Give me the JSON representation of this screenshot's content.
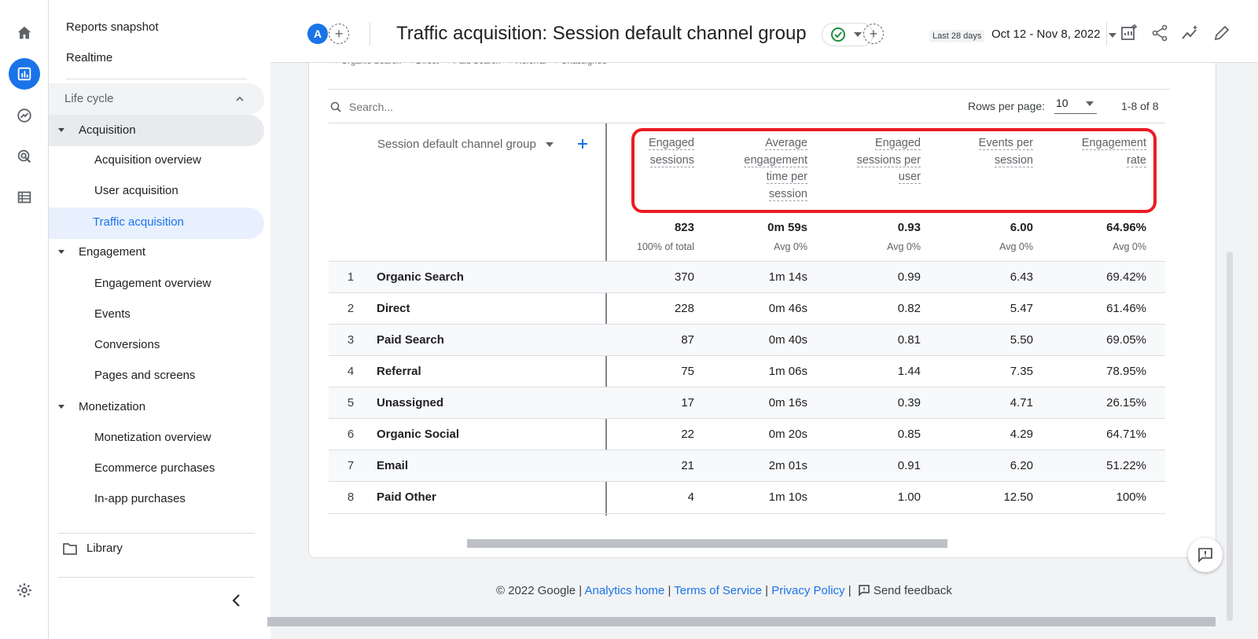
{
  "nav": {
    "reports_snapshot": "Reports snapshot",
    "realtime": "Realtime",
    "lifecycle": "Life cycle",
    "acquisition": "Acquisition",
    "acquisition_overview": "Acquisition overview",
    "user_acquisition": "User acquisition",
    "traffic_acquisition": "Traffic acquisition",
    "engagement": "Engagement",
    "engagement_overview": "Engagement overview",
    "events": "Events",
    "conversions": "Conversions",
    "pages_and_screens": "Pages and screens",
    "monetization": "Monetization",
    "monetization_overview": "Monetization overview",
    "ecommerce_purchases": "Ecommerce purchases",
    "in_app_purchases": "In-app purchases",
    "library": "Library"
  },
  "header": {
    "avatar_letter": "A",
    "title": "Traffic acquisition: Session default channel group",
    "date_preset": "Last 28 days",
    "date_range": "Oct 12 - Nov 8, 2022"
  },
  "legend": {
    "items": [
      "Organic Search",
      "Direct",
      "Paid Search",
      "Referral",
      "Unassigned"
    ]
  },
  "toolbar": {
    "search_placeholder": "Search...",
    "rows_per_page_label": "Rows per page:",
    "rows_per_page_value": "10",
    "pager": "1-8 of 8"
  },
  "table": {
    "dimension_header": "Session default channel group",
    "metric_headers": [
      [
        "Engaged",
        "sessions"
      ],
      [
        "Average",
        "engagement",
        "time per",
        "session"
      ],
      [
        "Engaged",
        "sessions per",
        "user"
      ],
      [
        "Events per",
        "session"
      ],
      [
        "Engagement",
        "rate"
      ]
    ],
    "totals": [
      "823",
      "0m 59s",
      "0.93",
      "6.00",
      "64.96%"
    ],
    "totals_sub": [
      "100% of total",
      "Avg 0%",
      "Avg 0%",
      "Avg 0%",
      "Avg 0%"
    ],
    "rows": [
      {
        "n": "1",
        "name": "Organic Search",
        "v": [
          "370",
          "1m 14s",
          "0.99",
          "6.43",
          "69.42%"
        ]
      },
      {
        "n": "2",
        "name": "Direct",
        "v": [
          "228",
          "0m 46s",
          "0.82",
          "5.47",
          "61.46%"
        ]
      },
      {
        "n": "3",
        "name": "Paid Search",
        "v": [
          "87",
          "0m 40s",
          "0.81",
          "5.50",
          "69.05%"
        ]
      },
      {
        "n": "4",
        "name": "Referral",
        "v": [
          "75",
          "1m 06s",
          "1.44",
          "7.35",
          "78.95%"
        ]
      },
      {
        "n": "5",
        "name": "Unassigned",
        "v": [
          "17",
          "0m 16s",
          "0.39",
          "4.71",
          "26.15%"
        ]
      },
      {
        "n": "6",
        "name": "Organic Social",
        "v": [
          "22",
          "0m 20s",
          "0.85",
          "4.29",
          "64.71%"
        ]
      },
      {
        "n": "7",
        "name": "Email",
        "v": [
          "21",
          "2m 01s",
          "0.91",
          "6.20",
          "51.22%"
        ]
      },
      {
        "n": "8",
        "name": "Paid Other",
        "v": [
          "4",
          "1m 10s",
          "1.00",
          "12.50",
          "100%"
        ]
      }
    ]
  },
  "footer": {
    "copyright": "© 2022 Google |",
    "analytics_home": "Analytics home",
    "sep1": "|",
    "terms": "Terms of Service",
    "sep2": "|",
    "privacy": "Privacy Policy",
    "sep3": "|",
    "send_feedback": "Send feedback"
  },
  "colors": {
    "accent": "#1a73e8",
    "highlight": "#ea1c24",
    "success": "#1e8e3e"
  },
  "icons": [
    "home-icon",
    "reports-icon",
    "explore-icon",
    "advertising-icon",
    "list-icon",
    "settings-icon",
    "collapse-icon",
    "library-folder-icon",
    "customize-report-icon",
    "share-icon",
    "insights-icon",
    "edit-icon",
    "feedback-icon"
  ]
}
